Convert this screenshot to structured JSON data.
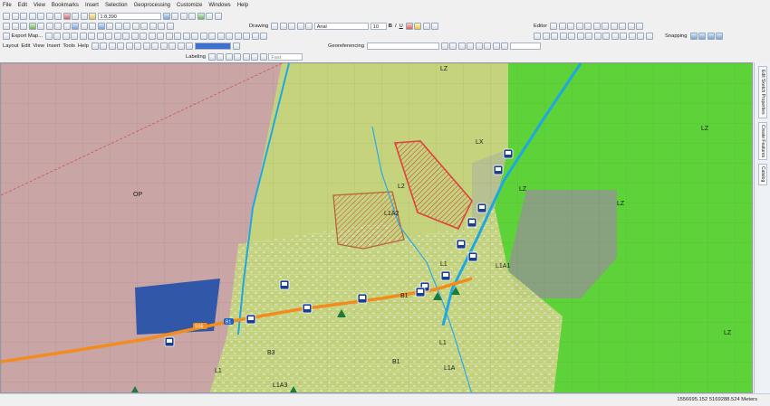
{
  "menu": [
    "File",
    "Edit",
    "View",
    "Bookmarks",
    "Insert",
    "Selection",
    "Geoprocessing",
    "Customize",
    "Windows",
    "Help"
  ],
  "toolbar": {
    "scale_value": "1:8,390",
    "drawing_label": "Drawing",
    "font_name": "Arial",
    "font_size": "10",
    "bold": "B",
    "italic": "I",
    "underline": "U",
    "editor_label": "Editor",
    "export_map_label": "Export Map...",
    "georef_label": "Georeferencing",
    "layout_label": "Layout",
    "edit_label": "Edit",
    "view_label": "View",
    "insert_label": "Insert",
    "tools_label": "Tools",
    "help_label": "Help",
    "labeling_label": "Labeling",
    "fast_label": "Fast",
    "snapping_label": "Snapping"
  },
  "right_dock": {
    "tab1": "Edit Sketch Properties",
    "tab2": "Create Features",
    "tab3": "Catalog"
  },
  "status": {
    "coordinates": "1556695.152  5169288.524 Meters"
  },
  "map": {
    "zone_labels": [
      "LZ",
      "LX",
      "LZ",
      "LZ",
      "LZ",
      "LZ",
      "OP",
      "L1A2",
      "L1",
      "L1A1",
      "B1",
      "B3",
      "B1",
      "L1",
      "L1A",
      "L1A3",
      "L1",
      "L2"
    ],
    "road_shields": [
      "SS5",
      "B1"
    ],
    "colors": {
      "industrial_pink": "#c9a3a6",
      "residential_yellow": "#c6d67a",
      "agri_green": "#4fd62a",
      "public_blue": "#1f4fa8",
      "grey_zone": "#8a9e82",
      "road_orange": "#f28c1e",
      "canal_blue": "#1fa7e3",
      "highlight_red": "#e04040"
    }
  }
}
